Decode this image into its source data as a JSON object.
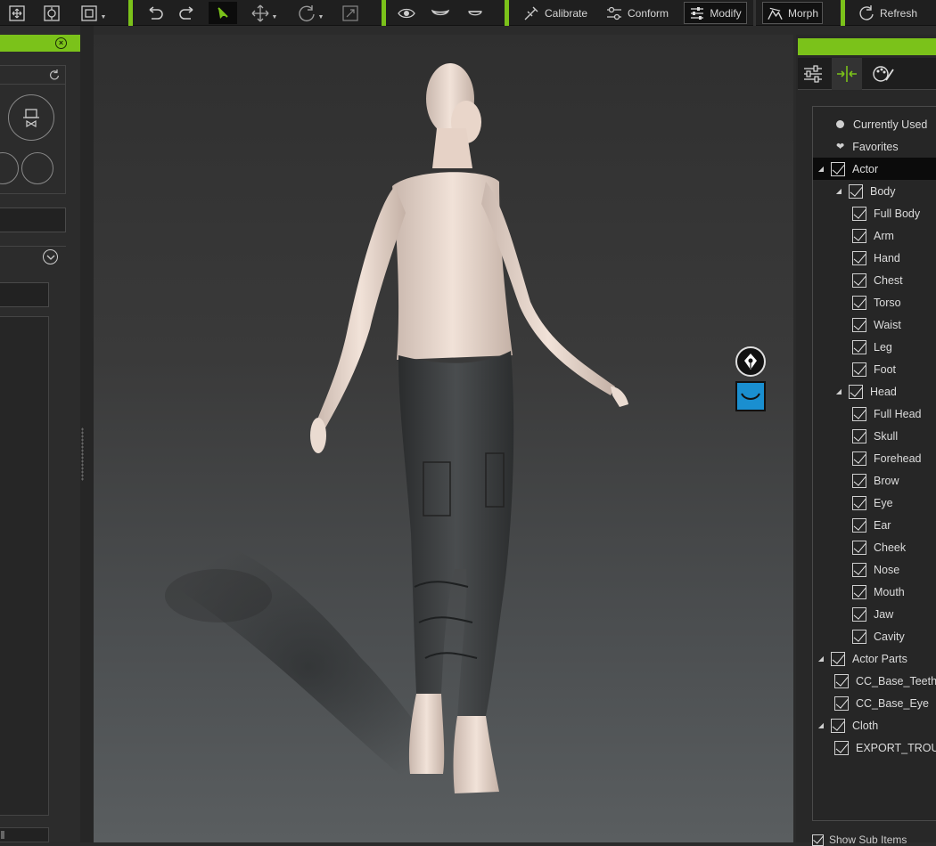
{
  "toolbar": {
    "icons": [
      "move-camera-icon",
      "frame-selected-icon",
      "fit-view-icon",
      "undo-icon",
      "redo-icon",
      "select-icon",
      "move-icon",
      "rotate-icon",
      "scale-icon",
      "eye-icon",
      "mouth-icon",
      "lip-icon"
    ],
    "calibrate_label": "Calibrate",
    "conform_label": "Conform",
    "modify_label": "Modify",
    "morph_label": "Morph",
    "refresh_label": "Refresh",
    "accent_color": "#7bc21a"
  },
  "right_panel": {
    "tabs": [
      "sliders-tab",
      "morph-tab",
      "palette-tab"
    ],
    "tree": [
      {
        "label": "Currently Used",
        "kind": "dot"
      },
      {
        "label": "Favorites",
        "kind": "heart"
      },
      {
        "label": "Actor",
        "kind": "group",
        "level": 0,
        "selected": true
      },
      {
        "label": "Body",
        "kind": "group",
        "level": 1
      },
      {
        "label": "Full Body",
        "level": 2
      },
      {
        "label": "Arm",
        "level": 2
      },
      {
        "label": "Hand",
        "level": 2
      },
      {
        "label": "Chest",
        "level": 2
      },
      {
        "label": "Torso",
        "level": 2
      },
      {
        "label": "Waist",
        "level": 2
      },
      {
        "label": "Leg",
        "level": 2
      },
      {
        "label": "Foot",
        "level": 2
      },
      {
        "label": "Head",
        "kind": "group",
        "level": 1
      },
      {
        "label": "Full Head",
        "level": 2
      },
      {
        "label": "Skull",
        "level": 2
      },
      {
        "label": "Forehead",
        "level": 2
      },
      {
        "label": "Brow",
        "level": 2
      },
      {
        "label": "Eye",
        "level": 2
      },
      {
        "label": "Ear",
        "level": 2
      },
      {
        "label": "Cheek",
        "level": 2
      },
      {
        "label": "Nose",
        "level": 2
      },
      {
        "label": "Mouth",
        "level": 2
      },
      {
        "label": "Jaw",
        "level": 2
      },
      {
        "label": "Cavity",
        "level": 2
      },
      {
        "label": "Actor Parts",
        "kind": "group",
        "level": 0
      },
      {
        "label": "CC_Base_Teeth",
        "level": 1
      },
      {
        "label": "CC_Base_Eye",
        "level": 1
      },
      {
        "label": "Cloth",
        "kind": "group",
        "level": 0
      },
      {
        "label": "EXPORT_TROUSERS",
        "level": 1
      }
    ],
    "footer_label": "Show Sub Items"
  }
}
